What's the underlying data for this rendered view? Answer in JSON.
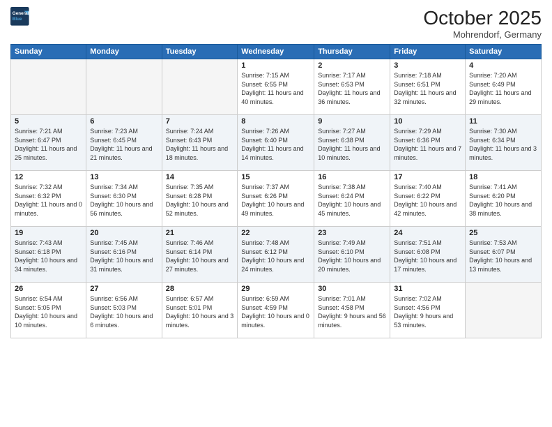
{
  "logo": {
    "line1": "General",
    "line2": "Blue"
  },
  "header": {
    "month": "October 2025",
    "location": "Mohrendorf, Germany"
  },
  "weekdays": [
    "Sunday",
    "Monday",
    "Tuesday",
    "Wednesday",
    "Thursday",
    "Friday",
    "Saturday"
  ],
  "weeks": [
    [
      {
        "day": "",
        "empty": true
      },
      {
        "day": "",
        "empty": true
      },
      {
        "day": "",
        "empty": true
      },
      {
        "day": "1",
        "sunrise": "7:15 AM",
        "sunset": "6:55 PM",
        "daylight": "11 hours and 40 minutes."
      },
      {
        "day": "2",
        "sunrise": "7:17 AM",
        "sunset": "6:53 PM",
        "daylight": "11 hours and 36 minutes."
      },
      {
        "day": "3",
        "sunrise": "7:18 AM",
        "sunset": "6:51 PM",
        "daylight": "11 hours and 32 minutes."
      },
      {
        "day": "4",
        "sunrise": "7:20 AM",
        "sunset": "6:49 PM",
        "daylight": "11 hours and 29 minutes."
      }
    ],
    [
      {
        "day": "5",
        "sunrise": "7:21 AM",
        "sunset": "6:47 PM",
        "daylight": "11 hours and 25 minutes."
      },
      {
        "day": "6",
        "sunrise": "7:23 AM",
        "sunset": "6:45 PM",
        "daylight": "11 hours and 21 minutes."
      },
      {
        "day": "7",
        "sunrise": "7:24 AM",
        "sunset": "6:43 PM",
        "daylight": "11 hours and 18 minutes."
      },
      {
        "day": "8",
        "sunrise": "7:26 AM",
        "sunset": "6:40 PM",
        "daylight": "11 hours and 14 minutes."
      },
      {
        "day": "9",
        "sunrise": "7:27 AM",
        "sunset": "6:38 PM",
        "daylight": "11 hours and 10 minutes."
      },
      {
        "day": "10",
        "sunrise": "7:29 AM",
        "sunset": "6:36 PM",
        "daylight": "11 hours and 7 minutes."
      },
      {
        "day": "11",
        "sunrise": "7:30 AM",
        "sunset": "6:34 PM",
        "daylight": "11 hours and 3 minutes."
      }
    ],
    [
      {
        "day": "12",
        "sunrise": "7:32 AM",
        "sunset": "6:32 PM",
        "daylight": "11 hours and 0 minutes."
      },
      {
        "day": "13",
        "sunrise": "7:34 AM",
        "sunset": "6:30 PM",
        "daylight": "10 hours and 56 minutes."
      },
      {
        "day": "14",
        "sunrise": "7:35 AM",
        "sunset": "6:28 PM",
        "daylight": "10 hours and 52 minutes."
      },
      {
        "day": "15",
        "sunrise": "7:37 AM",
        "sunset": "6:26 PM",
        "daylight": "10 hours and 49 minutes."
      },
      {
        "day": "16",
        "sunrise": "7:38 AM",
        "sunset": "6:24 PM",
        "daylight": "10 hours and 45 minutes."
      },
      {
        "day": "17",
        "sunrise": "7:40 AM",
        "sunset": "6:22 PM",
        "daylight": "10 hours and 42 minutes."
      },
      {
        "day": "18",
        "sunrise": "7:41 AM",
        "sunset": "6:20 PM",
        "daylight": "10 hours and 38 minutes."
      }
    ],
    [
      {
        "day": "19",
        "sunrise": "7:43 AM",
        "sunset": "6:18 PM",
        "daylight": "10 hours and 34 minutes."
      },
      {
        "day": "20",
        "sunrise": "7:45 AM",
        "sunset": "6:16 PM",
        "daylight": "10 hours and 31 minutes."
      },
      {
        "day": "21",
        "sunrise": "7:46 AM",
        "sunset": "6:14 PM",
        "daylight": "10 hours and 27 minutes."
      },
      {
        "day": "22",
        "sunrise": "7:48 AM",
        "sunset": "6:12 PM",
        "daylight": "10 hours and 24 minutes."
      },
      {
        "day": "23",
        "sunrise": "7:49 AM",
        "sunset": "6:10 PM",
        "daylight": "10 hours and 20 minutes."
      },
      {
        "day": "24",
        "sunrise": "7:51 AM",
        "sunset": "6:08 PM",
        "daylight": "10 hours and 17 minutes."
      },
      {
        "day": "25",
        "sunrise": "7:53 AM",
        "sunset": "6:07 PM",
        "daylight": "10 hours and 13 minutes."
      }
    ],
    [
      {
        "day": "26",
        "sunrise": "6:54 AM",
        "sunset": "5:05 PM",
        "daylight": "10 hours and 10 minutes."
      },
      {
        "day": "27",
        "sunrise": "6:56 AM",
        "sunset": "5:03 PM",
        "daylight": "10 hours and 6 minutes."
      },
      {
        "day": "28",
        "sunrise": "6:57 AM",
        "sunset": "5:01 PM",
        "daylight": "10 hours and 3 minutes."
      },
      {
        "day": "29",
        "sunrise": "6:59 AM",
        "sunset": "4:59 PM",
        "daylight": "10 hours and 0 minutes."
      },
      {
        "day": "30",
        "sunrise": "7:01 AM",
        "sunset": "4:58 PM",
        "daylight": "9 hours and 56 minutes."
      },
      {
        "day": "31",
        "sunrise": "7:02 AM",
        "sunset": "4:56 PM",
        "daylight": "9 hours and 53 minutes."
      },
      {
        "day": "",
        "empty": true
      }
    ]
  ]
}
